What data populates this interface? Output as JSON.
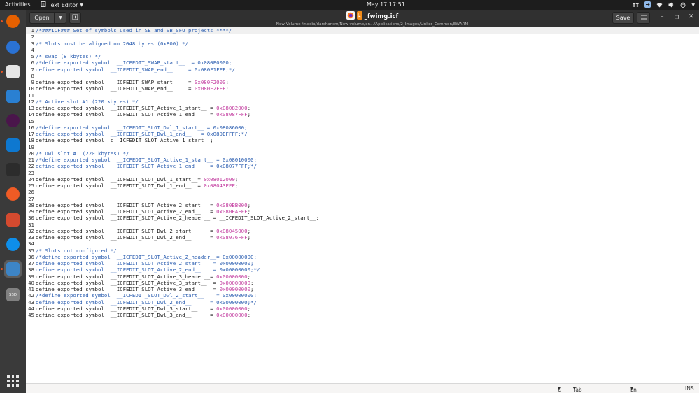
{
  "topbar": {
    "activities": "Activities",
    "app_name": "Text Editor",
    "clock": "May 17  17:51"
  },
  "headerbar": {
    "open_label": "Open",
    "title": "_fwimg.icf",
    "path": "New Volume /media/darshansm/New volume/en.../Applications/2_Images/Linker_Common/EWARM",
    "save_label": "Save"
  },
  "dock": {
    "items": [
      {
        "name": "firefox-icon",
        "color": "#e66000"
      },
      {
        "name": "thunderbird-icon",
        "color": "#2a72d4"
      },
      {
        "name": "files-icon",
        "color": "#e5e5e5"
      },
      {
        "name": "libreoffice-writer-icon",
        "color": "#2a80d2"
      },
      {
        "name": "slack-icon",
        "color": "#4a154b"
      },
      {
        "name": "vscode-icon",
        "color": "#0e78d0"
      },
      {
        "name": "terminal-icon",
        "color": "#2c2c2c"
      },
      {
        "name": "postman-icon",
        "color": "#ef5b25"
      },
      {
        "name": "document-viewer-icon",
        "color": "#d44a2f"
      },
      {
        "name": "teamviewer-icon",
        "color": "#0e8ee9"
      },
      {
        "name": "text-editor-icon",
        "color": "#3d85c6"
      },
      {
        "name": "ssd-drive-icon",
        "color": "#808080"
      }
    ],
    "ssd_label": "SSD",
    "show_apps": "show-applications-icon"
  },
  "editor": {
    "lines": [
      {
        "n": "1",
        "segments": [
          {
            "t": "/*###ICF### Set of symbols used in SE and SB_SFU projects ****/",
            "c": "cmt"
          }
        ]
      },
      {
        "n": "2",
        "segments": []
      },
      {
        "n": "3",
        "segments": [
          {
            "t": "/* Slots must be aligned on 2048 bytes (0x800) */",
            "c": "cmt"
          }
        ]
      },
      {
        "n": "4",
        "segments": []
      },
      {
        "n": "5",
        "segments": [
          {
            "t": "/* swap (8 kbytes) */",
            "c": "cmt"
          }
        ]
      },
      {
        "n": "6",
        "segments": [
          {
            "t": "/*define exported symbol  __ICFEDIT_SWAP_start__  = 0x080F0000;",
            "c": "cmt"
          }
        ]
      },
      {
        "n": "7",
        "segments": [
          {
            "t": "define exported symbol  __ICFEDIT_SWAP_end__     = 0x080F1FFF;*/",
            "c": "cmt"
          }
        ]
      },
      {
        "n": "8",
        "segments": []
      },
      {
        "n": "9",
        "segments": [
          {
            "t": "define exported symbol  __ICFEDIT_SWAP_start__   = ",
            "c": "plain"
          },
          {
            "t": "0x080F2000",
            "c": "num"
          },
          {
            "t": ";",
            "c": "plain"
          }
        ]
      },
      {
        "n": "10",
        "segments": [
          {
            "t": "define exported symbol  __ICFEDIT_SWAP_end__     = ",
            "c": "plain"
          },
          {
            "t": "0x080F2FFF",
            "c": "num"
          },
          {
            "t": ";",
            "c": "plain"
          }
        ]
      },
      {
        "n": "11",
        "segments": []
      },
      {
        "n": "12",
        "segments": [
          {
            "t": "/* Active slot #1 (220 kbytes) */",
            "c": "cmt"
          }
        ]
      },
      {
        "n": "13",
        "segments": [
          {
            "t": "define exported symbol  __ICFEDIT_SLOT_Active_1_start__ = ",
            "c": "plain"
          },
          {
            "t": "0x08082000",
            "c": "num"
          },
          {
            "t": ";",
            "c": "plain"
          }
        ]
      },
      {
        "n": "14",
        "segments": [
          {
            "t": "define exported symbol  __ICFEDIT_SLOT_Active_1_end__   = ",
            "c": "plain"
          },
          {
            "t": "0x08087FFF",
            "c": "num"
          },
          {
            "t": ";",
            "c": "plain"
          }
        ]
      },
      {
        "n": "15",
        "segments": []
      },
      {
        "n": "16",
        "segments": [
          {
            "t": "/*define exported symbol  __ICFEDIT_SLOT_Dwl_1_start__ = 0x08086000;",
            "c": "cmt"
          }
        ]
      },
      {
        "n": "17",
        "segments": [
          {
            "t": "define exported symbol  __ICFEDIT_SLOT_Dwl_1_end__   = 0x080EFFFF;*/",
            "c": "cmt"
          }
        ]
      },
      {
        "n": "18",
        "segments": [
          {
            "t": "define exported symbol  c__ICFEDIT_SLOT_Active_1_start__;",
            "c": "plain"
          }
        ]
      },
      {
        "n": "19",
        "segments": []
      },
      {
        "n": "20",
        "segments": [
          {
            "t": "/* Dwl slot #1 (220 kbytes) */",
            "c": "cmt"
          }
        ]
      },
      {
        "n": "21",
        "segments": [
          {
            "t": "/*define exported symbol  __ICFEDIT_SLOT_Active_1_start__ = 0x08010000;",
            "c": "cmt"
          }
        ]
      },
      {
        "n": "22",
        "segments": [
          {
            "t": "define exported symbol  __ICFEDIT_SLOT_Active_1_end__   = 0x08077FFF;*/",
            "c": "cmt"
          }
        ]
      },
      {
        "n": "23",
        "segments": []
      },
      {
        "n": "24",
        "segments": [
          {
            "t": "define exported symbol  __ICFEDIT_SLOT_Dwl_1_start__= ",
            "c": "plain"
          },
          {
            "t": "0x08012000",
            "c": "num"
          },
          {
            "t": ";",
            "c": "plain"
          }
        ]
      },
      {
        "n": "25",
        "segments": [
          {
            "t": "define exported symbol  __ICFEDIT_SLOT_Dwl_1_end__  = ",
            "c": "plain"
          },
          {
            "t": "0x08043FFF",
            "c": "num"
          },
          {
            "t": ";",
            "c": "plain"
          }
        ]
      },
      {
        "n": "26",
        "segments": []
      },
      {
        "n": "27",
        "segments": []
      },
      {
        "n": "28",
        "segments": [
          {
            "t": "define exported symbol  __ICFEDIT_SLOT_Active_2_start__ = ",
            "c": "plain"
          },
          {
            "t": "0x080BB000",
            "c": "num"
          },
          {
            "t": ";",
            "c": "plain"
          }
        ]
      },
      {
        "n": "29",
        "segments": [
          {
            "t": "define exported symbol  __ICFEDIT_SLOT_Active_2_end__   = ",
            "c": "plain"
          },
          {
            "t": "0x080EAFFF",
            "c": "num"
          },
          {
            "t": ";",
            "c": "plain"
          }
        ]
      },
      {
        "n": "30",
        "segments": [
          {
            "t": "define exported symbol  __ICFEDIT_SLOT_Active_2_header__ = __ICFEDIT_SLOT_Active_2_start__;",
            "c": "plain"
          }
        ]
      },
      {
        "n": "31",
        "segments": []
      },
      {
        "n": "32",
        "segments": [
          {
            "t": "define exported symbol  __ICFEDIT_SLOT_Dwl_2_start__    = ",
            "c": "plain"
          },
          {
            "t": "0x08045000",
            "c": "num"
          },
          {
            "t": ";",
            "c": "plain"
          }
        ]
      },
      {
        "n": "33",
        "segments": [
          {
            "t": "define exported symbol  __ICFEDIT_SLOT_Dwl_2_end__      = ",
            "c": "plain"
          },
          {
            "t": "0x08076FFF",
            "c": "num"
          },
          {
            "t": ";",
            "c": "plain"
          }
        ]
      },
      {
        "n": "34",
        "segments": []
      },
      {
        "n": "35",
        "segments": [
          {
            "t": "/* Slots not configured */",
            "c": "cmt"
          }
        ]
      },
      {
        "n": "36",
        "segments": [
          {
            "t": "/*define exported symbol  __ICFEDIT_SLOT_Active_2_header__= 0x00000000;",
            "c": "cmt"
          }
        ]
      },
      {
        "n": "37",
        "segments": [
          {
            "t": "define exported symbol  __ICFEDIT_SLOT_Active_2_start__  = 0x00000000;",
            "c": "cmt"
          }
        ]
      },
      {
        "n": "38",
        "segments": [
          {
            "t": "define exported symbol  __ICFEDIT_SLOT_Active_2_end__    = 0x00000000;*/",
            "c": "cmt"
          }
        ]
      },
      {
        "n": "39",
        "segments": [
          {
            "t": "define exported symbol  __ICFEDIT_SLOT_Active_3_header__= ",
            "c": "plain"
          },
          {
            "t": "0x00000000",
            "c": "num"
          },
          {
            "t": ";",
            "c": "plain"
          }
        ]
      },
      {
        "n": "40",
        "segments": [
          {
            "t": "define exported symbol  __ICFEDIT_SLOT_Active_3_start__  = ",
            "c": "plain"
          },
          {
            "t": "0x00000000",
            "c": "num"
          },
          {
            "t": ";",
            "c": "plain"
          }
        ]
      },
      {
        "n": "41",
        "segments": [
          {
            "t": "define exported symbol  __ICFEDIT_SLOT_Active_3_end__    = ",
            "c": "plain"
          },
          {
            "t": "0x00000000",
            "c": "num"
          },
          {
            "t": ";",
            "c": "plain"
          }
        ]
      },
      {
        "n": "42",
        "segments": [
          {
            "t": "/*define exported symbol  __ICFEDIT_SLOT_Dwl_2_start__    = 0x00000000;",
            "c": "cmt"
          }
        ]
      },
      {
        "n": "43",
        "segments": [
          {
            "t": "define exported symbol  __ICFEDIT_SLOT_Dwl_2_end__      = 0x00000000;*/",
            "c": "cmt"
          }
        ]
      },
      {
        "n": "44",
        "segments": [
          {
            "t": "define exported symbol  __ICFEDIT_SLOT_Dwl_3_start__    = ",
            "c": "plain"
          },
          {
            "t": "0x00000000",
            "c": "num"
          },
          {
            "t": ";",
            "c": "plain"
          }
        ]
      },
      {
        "n": "45",
        "segments": [
          {
            "t": "define exported symbol  __ICFEDIT_SLOT_Dwl_3_end__      = ",
            "c": "plain"
          },
          {
            "t": "0x00000000",
            "c": "num"
          },
          {
            "t": ";",
            "c": "plain"
          }
        ]
      }
    ]
  },
  "statusbar": {
    "language": "C",
    "tab_width": "Tab Width: 8",
    "position": "Ln 1, Col 1",
    "mode": "INS"
  },
  "colors": {
    "comment": "#2a5db0",
    "number": "#c23a9e",
    "accent": "#e95420"
  }
}
